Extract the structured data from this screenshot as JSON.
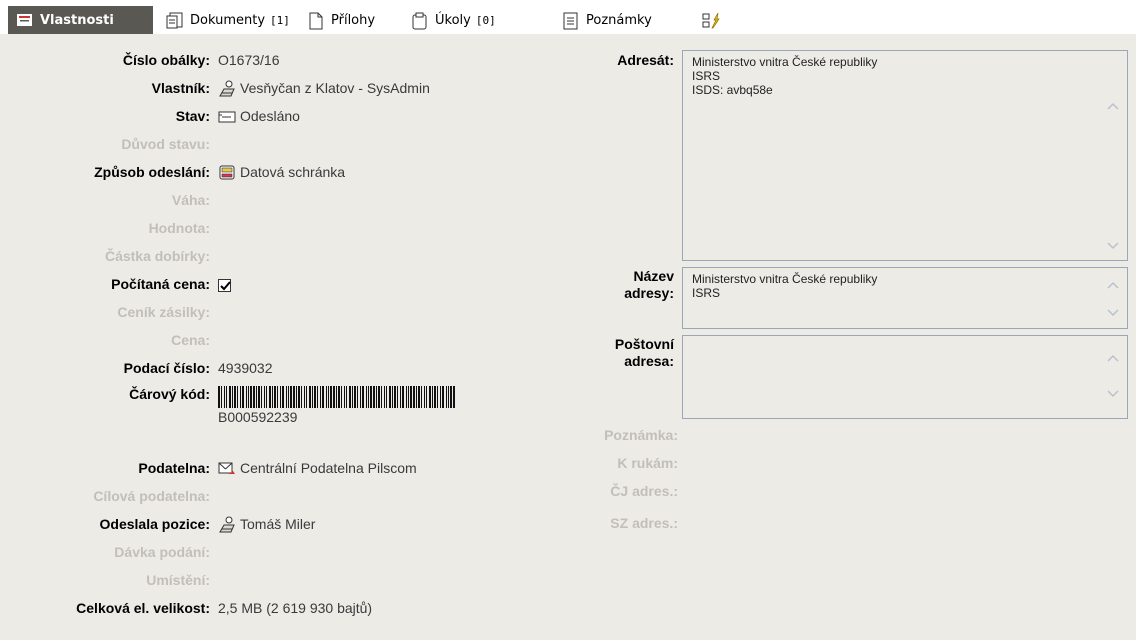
{
  "tabs": [
    {
      "label": "Vlastnosti",
      "count": "",
      "icon": "properties-icon",
      "active": true
    },
    {
      "label": "Dokumenty",
      "count": "[1]",
      "icon": "documents-icon",
      "active": false
    },
    {
      "label": "Přílohy",
      "count": "",
      "icon": "attachment-icon",
      "active": false
    },
    {
      "label": "Úkoly",
      "count": "[0]",
      "icon": "clipboard-icon",
      "active": false
    },
    {
      "label": "Poznámky",
      "count": "",
      "icon": "notes-icon",
      "active": false
    }
  ],
  "fields": {
    "cislo_obalky": {
      "label": "Číslo obálky:",
      "value": "O1673/16"
    },
    "vlastnik": {
      "label": "Vlastník:",
      "value": "Vesňyčan z Klatov - SysAdmin",
      "icon": "user-icon"
    },
    "stav": {
      "label": "Stav:",
      "value": "Odesláno",
      "icon": "envelope-icon"
    },
    "duvod_stavu": {
      "label": "Důvod stavu:"
    },
    "zpusob_odeslani": {
      "label": "Způsob odeslání:",
      "value": "Datová schránka",
      "icon": "databox-icon"
    },
    "vaha": {
      "label": "Váha:"
    },
    "hodnota": {
      "label": "Hodnota:"
    },
    "castka_dobirky": {
      "label": "Částka dobírky:"
    },
    "pocitana_cena": {
      "label": "Počítaná cena:",
      "checked": true
    },
    "cenik_zasilky": {
      "label": "Ceník zásilky:"
    },
    "cena": {
      "label": "Cena:"
    },
    "podaci_cislo": {
      "label": "Podací číslo:",
      "value": "4939032"
    },
    "carovy_kod": {
      "label": "Čárový kód:",
      "value": "B000592239"
    },
    "podatelna": {
      "label": "Podatelna:",
      "value": "Centrální Podatelna Pilscom",
      "icon": "mailroom-icon"
    },
    "cilova_podatelna": {
      "label": "Cílová podatelna:"
    },
    "odeslala_pozice": {
      "label": "Odeslala pozice:",
      "value": "Tomáš Miler",
      "icon": "user-icon"
    },
    "davka_podani": {
      "label": "Dávka podání:"
    },
    "umisteni": {
      "label": "Umístění:"
    },
    "celkova_velikost": {
      "label": "Celková el. velikost:",
      "value": "2,5 MB (2 619 930 bajtů)"
    }
  },
  "right": {
    "adresat": {
      "label": "Adresát:",
      "lines": [
        "Ministerstvo vnitra České republiky",
        "ISRS",
        "ISDS: avbq58e"
      ]
    },
    "nazev_adresy": {
      "label1": "Název",
      "label2": "adresy:",
      "lines": [
        "Ministerstvo vnitra České republiky",
        "ISRS"
      ]
    },
    "postovni_adresa": {
      "label1": "Poštovní",
      "label2": "adresa:",
      "lines": []
    },
    "poznamka": {
      "label": "Poznámka:"
    },
    "k_rukam": {
      "label": "K rukám:"
    },
    "cj_adres": {
      "label": "ČJ adres.:"
    },
    "sz_adres": {
      "label": "SZ adres.:"
    }
  }
}
